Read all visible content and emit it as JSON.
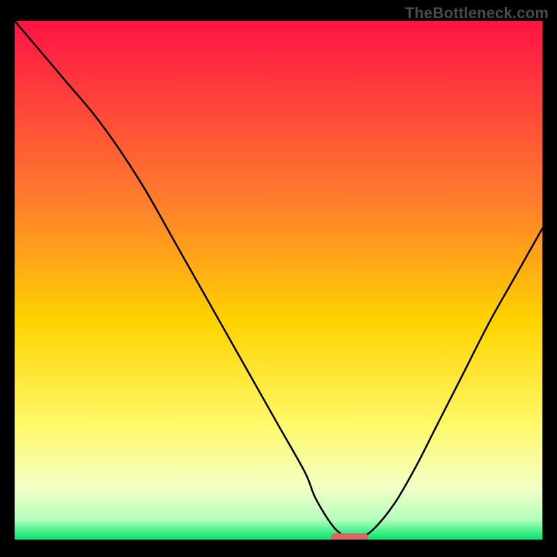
{
  "watermark": "TheBottleneck.com",
  "colors": {
    "top": "#ff1345",
    "mid_high": "#ff7e2d",
    "mid": "#ffd300",
    "mid_low": "#fff96a",
    "low1": "#f2ffc6",
    "low2": "#b8ffbf",
    "bottom": "#00e66b",
    "curve": "#000000",
    "marker": "#d46a62",
    "frame": "#000000"
  },
  "chart_data": {
    "type": "line",
    "title": "",
    "xlabel": "",
    "ylabel": "",
    "xlim": [
      0,
      100
    ],
    "ylim": [
      0,
      100
    ],
    "x": [
      0,
      5,
      10,
      15,
      20,
      25,
      30,
      35,
      40,
      45,
      50,
      55,
      57,
      60,
      62,
      64,
      65,
      68,
      72,
      76,
      80,
      85,
      90,
      95,
      100
    ],
    "values": [
      100,
      94,
      88,
      82,
      75,
      67,
      58,
      49,
      40,
      31,
      22,
      13,
      8,
      3,
      1,
      0,
      0,
      2,
      7,
      14,
      22,
      32,
      42,
      51,
      60
    ],
    "minimum_x": 64,
    "marker": {
      "x_start": 60,
      "x_end": 67,
      "y": 0
    },
    "grid": false,
    "legend": false
  }
}
